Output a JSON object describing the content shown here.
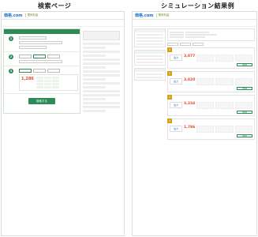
{
  "headings": {
    "left": "検索ページ",
    "right": "シミュレーション結果例"
  },
  "brand": {
    "logo": "価格.com",
    "sub": "電気料金"
  },
  "search": {
    "button": "検索する",
    "result_value": "1,286"
  },
  "results": {
    "cards": [
      {
        "rank": "1",
        "price": "3,877",
        "logo": "電力"
      },
      {
        "rank": "2",
        "price": "3,820",
        "logo": "電力"
      },
      {
        "rank": "3",
        "price": "3,334",
        "logo": "電力"
      },
      {
        "rank": "4",
        "price": "1,786",
        "logo": "電力"
      }
    ],
    "detail_label": "詳細"
  },
  "colors": {
    "accent": "#2e8b57",
    "price": "#e8452c",
    "brand": "#1a73c9"
  }
}
